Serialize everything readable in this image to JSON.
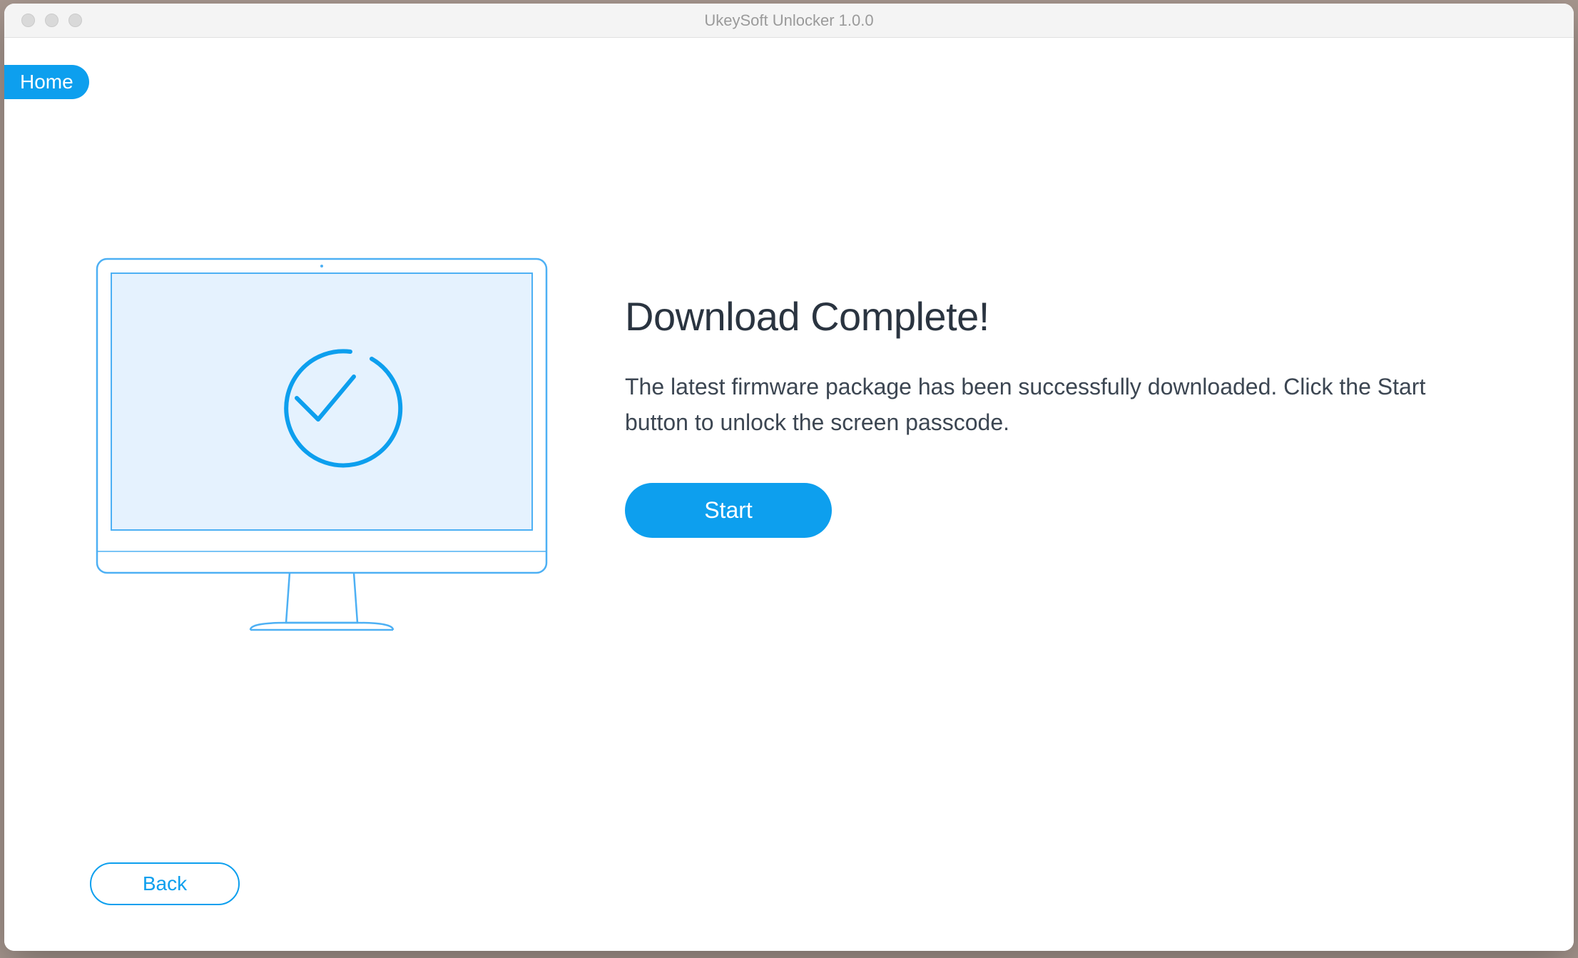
{
  "window": {
    "title": "UkeySoft Unlocker 1.0.0"
  },
  "nav": {
    "home_label": "Home"
  },
  "main": {
    "heading": "Download Complete!",
    "description": "The latest firmware package has been successfully downloaded. Click the Start button to unlock the screen passcode.",
    "start_label": "Start"
  },
  "footer": {
    "back_label": "Back"
  },
  "colors": {
    "accent": "#0d9fee",
    "illustration_stroke": "#4db0f4",
    "illustration_fill": "#e5f2fe",
    "text_heading": "#2a3440",
    "text_body": "#3c4652"
  }
}
